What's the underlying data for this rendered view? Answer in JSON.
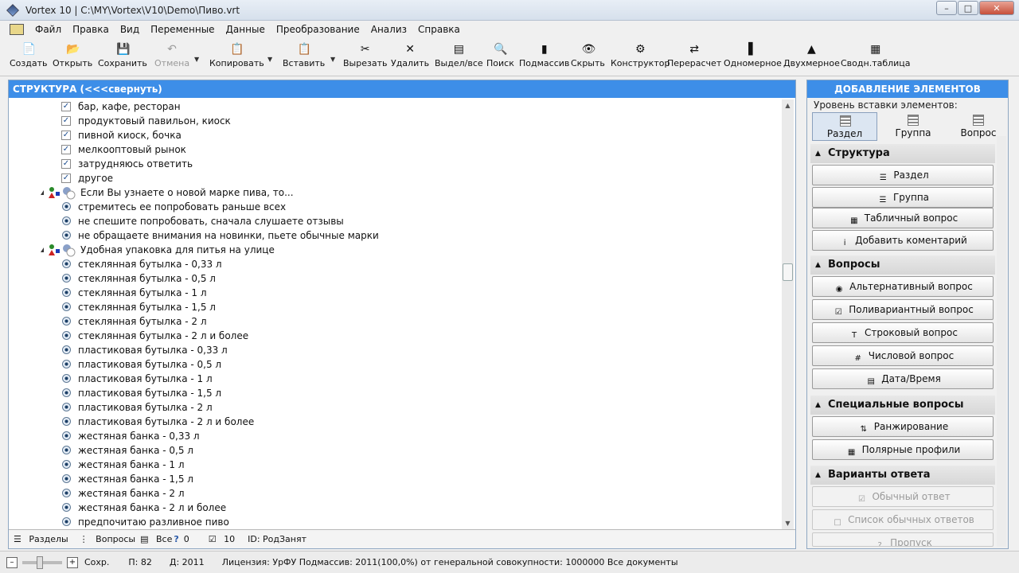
{
  "window": {
    "title": "Vortex 10 | C:\\MY\\Vortex\\V10\\Demo\\Пиво.vrt"
  },
  "menu": [
    "Файл",
    "Правка",
    "Вид",
    "Переменные",
    "Данные",
    "Преобразование",
    "Анализ",
    "Справка"
  ],
  "toolbar": {
    "create": "Создать",
    "open": "Открыть",
    "save": "Сохранить",
    "undo": "Отмена",
    "copy": "Копировать",
    "paste": "Вставить",
    "cut": "Вырезать",
    "delete": "Удалить",
    "select_all": "Выдел/все",
    "search": "Поиск",
    "subarray": "Подмассив",
    "hide": "Скрыть",
    "constructor": "Конструктор",
    "recalc": "Перерасчет",
    "onedim": "Одномерное",
    "twodim": "Двухмерное",
    "pivot": "Сводн.таблица"
  },
  "structure": {
    "header": "СТРУКТУРА (<<<свернуть)",
    "rows": [
      {
        "kind": "check",
        "text": "бар, кафе, ресторан"
      },
      {
        "kind": "check",
        "text": "продуктовый павильон, киоск"
      },
      {
        "kind": "check",
        "text": "пивной киоск, бочка"
      },
      {
        "kind": "check",
        "text": "мелкооптовый рынок"
      },
      {
        "kind": "check",
        "text": "затрудняюсь ответить"
      },
      {
        "kind": "check",
        "text": "другое"
      },
      {
        "kind": "question",
        "text": "Если Вы узнаете о новой марке пива, то..."
      },
      {
        "kind": "radio",
        "text": "стремитесь ее попробовать раньше всех"
      },
      {
        "kind": "radio",
        "text": "не спешите попробовать, сначала слушаете отзывы"
      },
      {
        "kind": "radio",
        "text": "не обращаете внимания на новинки, пьете обычные марки"
      },
      {
        "kind": "question",
        "text": "Удобная упаковка для питья на улице"
      },
      {
        "kind": "radio",
        "text": "стеклянная бутылка - 0,33 л"
      },
      {
        "kind": "radio",
        "text": "стеклянная бутылка - 0,5 л"
      },
      {
        "kind": "radio",
        "text": "стеклянная бутылка - 1 л"
      },
      {
        "kind": "radio",
        "text": "стеклянная бутылка - 1,5 л"
      },
      {
        "kind": "radio",
        "text": "стеклянная бутылка - 2 л"
      },
      {
        "kind": "radio",
        "text": "стеклянная бутылка - 2 л и более"
      },
      {
        "kind": "radio",
        "text": "пластиковая бутылка - 0,33 л"
      },
      {
        "kind": "radio",
        "text": "пластиковая бутылка - 0,5 л"
      },
      {
        "kind": "radio",
        "text": "пластиковая бутылка - 1 л"
      },
      {
        "kind": "radio",
        "text": "пластиковая бутылка - 1,5 л"
      },
      {
        "kind": "radio",
        "text": "пластиковая бутылка - 2 л"
      },
      {
        "kind": "radio",
        "text": "пластиковая бутылка - 2 л и более"
      },
      {
        "kind": "radio",
        "text": "жестяная банка - 0,33 л"
      },
      {
        "kind": "radio",
        "text": "жестяная банка - 0,5 л"
      },
      {
        "kind": "radio",
        "text": "жестяная банка - 1 л"
      },
      {
        "kind": "radio",
        "text": "жестяная банка - 1,5 л"
      },
      {
        "kind": "radio",
        "text": "жестяная банка - 2 л"
      },
      {
        "kind": "radio",
        "text": "жестяная банка - 2 л и более"
      },
      {
        "kind": "radio",
        "text": "предпочитаю разливное пиво"
      }
    ],
    "bottom": {
      "sections": "Разделы",
      "questions": "Вопросы",
      "all": "Все",
      "help_count": "0",
      "count": "10",
      "id": "ID: РодЗанят"
    }
  },
  "add_panel": {
    "header": "ДОБАВЛЕНИЕ ЭЛЕМЕНТОВ",
    "level_label": "Уровень вставки элементов:",
    "levels": [
      "Раздел",
      "Группа",
      "Вопрос"
    ],
    "sections": [
      {
        "title": "Структура",
        "buttons": [
          "Раздел",
          "Группа",
          "Табличный вопрос",
          "Добавить коментарий"
        ]
      },
      {
        "title": "Вопросы",
        "buttons": [
          "Альтернативный вопрос",
          "Поливариантный вопрос",
          "Строковый вопрос",
          "Числовой вопрос",
          "Дата/Время"
        ]
      },
      {
        "title": "Специальные вопросы",
        "buttons": [
          "Ранжирование",
          "Полярные профили"
        ]
      },
      {
        "title": "Варианты ответа",
        "buttons": [
          "Обычный ответ",
          "Список обычных ответов",
          "Пропуск"
        ]
      }
    ]
  },
  "status": {
    "save": "Сохр.",
    "p": "П: 82",
    "d": "Д: 2011",
    "license": "Лицензия: УрФУ Подмассив: 2011(100,0%) от генеральной совокупности: 1000000 Все документы"
  }
}
